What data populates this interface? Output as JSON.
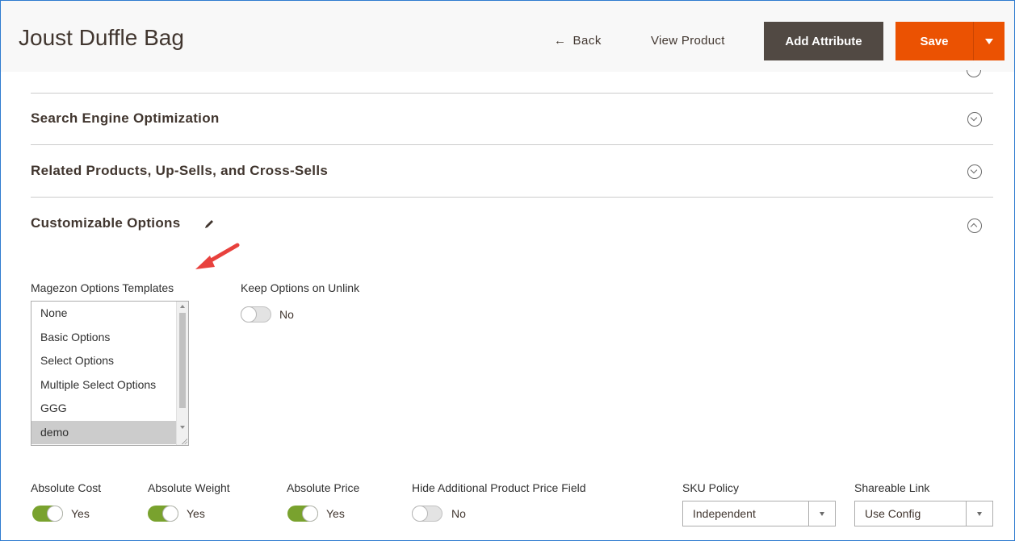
{
  "header": {
    "title": "Joust Duffle Bag",
    "back_label": "Back",
    "view_product_label": "View Product",
    "add_attribute_label": "Add Attribute",
    "save_label": "Save"
  },
  "sections": [
    {
      "title": "Search Engine Optimization",
      "state": "collapsed"
    },
    {
      "title": "Related Products, Up-Sells, and Cross-Sells",
      "state": "collapsed"
    },
    {
      "title": "Customizable Options",
      "state": "expanded"
    }
  ],
  "templates": {
    "label": "Magezon Options Templates",
    "options": [
      "None",
      "Basic Options",
      "Select Options",
      "Multiple Select Options",
      "GGG",
      "demo"
    ],
    "selected": "demo"
  },
  "keep_options": {
    "label": "Keep Options on Unlink",
    "value": "No",
    "on": false
  },
  "fields": {
    "absolute_cost": {
      "label": "Absolute Cost",
      "value": "Yes",
      "on": true
    },
    "absolute_weight": {
      "label": "Absolute Weight",
      "value": "Yes",
      "on": true
    },
    "absolute_price": {
      "label": "Absolute Price",
      "value": "Yes",
      "on": true
    },
    "hide_price": {
      "label": "Hide Additional Product Price Field",
      "value": "No",
      "on": false
    },
    "sku_policy": {
      "label": "SKU Policy",
      "value": "Independent"
    },
    "shareable_link": {
      "label": "Shareable Link",
      "value": "Use Config"
    }
  },
  "colors": {
    "accent": "#eb5202",
    "dark_button": "#514943",
    "toggle_on": "#79a22e",
    "annotation_arrow": "#e8413d"
  }
}
